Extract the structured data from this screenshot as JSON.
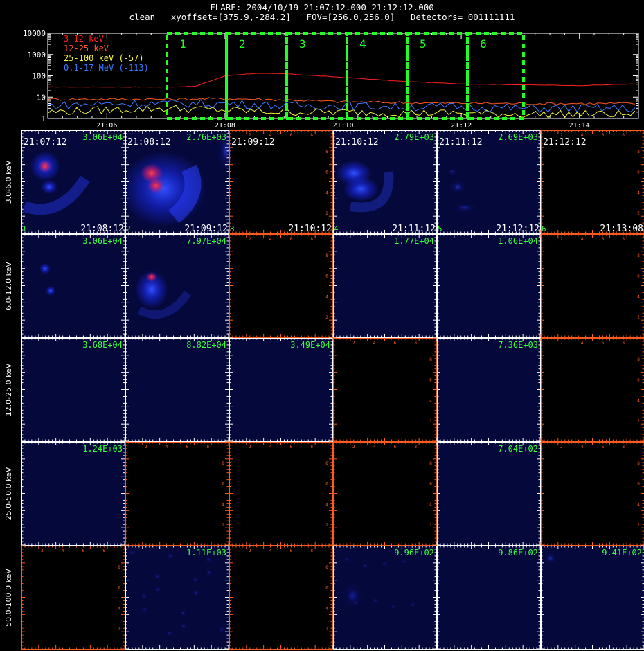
{
  "header": {
    "title_line1": "FLARE: 2004/10/19 21:07:12.000-21:12:12.000",
    "title_line2": "clean   xyoffset=[375.9,-284.2]   FOV=[256.0,256.0]   Detectors= 001111111"
  },
  "colors": {
    "band_3_12": "#ff2020",
    "band_12_25": "#ff5a1e",
    "band_25_100": "#f5f53c",
    "band_0p1_17": "#3c78ff",
    "interval_box": "#22ff22",
    "panel_label": "#3cff3c",
    "axis_orange": "#ff5a1e"
  },
  "chart_data": [
    {
      "type": "line",
      "yscale": "log",
      "ylim": [
        1,
        10000
      ],
      "y_ticks": [
        "1",
        "10",
        "100",
        "1000",
        "10000"
      ],
      "x_tick_labels": [
        "21:06",
        "21:08",
        "21:10",
        "21:12",
        "21:14"
      ],
      "xlim_minutes": [
        "21:05:00",
        "21:15:00"
      ],
      "legend_position": "top-left",
      "series": [
        {
          "name": "3-12 keV",
          "color_key": "band_3_12",
          "x": [
            "21:05",
            "21:06",
            "21:07",
            "21:07:30",
            "21:08",
            "21:08:30",
            "21:09",
            "21:10",
            "21:11",
            "21:12",
            "21:13",
            "21:14",
            "21:15"
          ],
          "y": [
            30,
            30,
            30,
            32,
            100,
            130,
            125,
            85,
            55,
            42,
            38,
            35,
            42
          ]
        },
        {
          "name": "12-25 keV",
          "color_key": "band_12_25",
          "x": [
            "21:05",
            "21:06",
            "21:07",
            "21:08",
            "21:09",
            "21:10",
            "21:11",
            "21:12",
            "21:13",
            "21:14",
            "21:15"
          ],
          "y": [
            8,
            8,
            8,
            8.5,
            7.5,
            6,
            5.5,
            5.2,
            5,
            5,
            5
          ]
        },
        {
          "name": "25-100 keV (-57)",
          "color_key": "band_25_100",
          "x": [
            "21:05",
            "21:06",
            "21:07",
            "21:08",
            "21:09",
            "21:10",
            "21:11",
            "21:12",
            "21:13",
            "21:14",
            "21:15"
          ],
          "y": [
            2,
            2.5,
            3,
            2.5,
            2,
            2,
            1.8,
            1.8,
            1.6,
            1.6,
            1.6
          ]
        },
        {
          "name": "0.1-17 MeV (-113)",
          "color_key": "band_0p1_17",
          "x": [
            "21:05",
            "21:06",
            "21:07",
            "21:08",
            "21:09",
            "21:10",
            "21:11",
            "21:12",
            "21:13",
            "21:14",
            "21:15"
          ],
          "y": [
            4,
            5,
            5,
            5,
            4,
            4,
            3.5,
            3.5,
            3,
            3,
            3
          ]
        }
      ],
      "intervals": [
        "1",
        "2",
        "3",
        "4",
        "5",
        "6"
      ]
    },
    {
      "type": "heatmap",
      "row_labels": [
        "3.0-6.0 keV",
        "6.0-12.0 keV",
        "12.0-25.0 keV",
        "25.0-50.0 keV",
        "50.0-100.0 keV"
      ],
      "tick_labels": [
        "2",
        "4",
        "6",
        "8"
      ],
      "row1_start_times": [
        "21:07:12",
        "21:08:12",
        "21:09:12",
        "21:10:12",
        "21:11:12",
        "21:12:12"
      ],
      "row1_end_times": [
        "21:08:12",
        "21:09:12",
        "21:10:12",
        "21:11:12",
        "21:12:12",
        "21:13:08"
      ],
      "column_numbers": [
        "1",
        "2",
        "3",
        "4",
        "5",
        "6"
      ],
      "max_values": [
        [
          "3.06E+04",
          "2.76E+03",
          "",
          "2.79E+03",
          "2.69E+03",
          ""
        ],
        [
          "3.06E+04",
          "7.97E+04",
          "",
          "1.77E+04",
          "1.06E+04",
          ""
        ],
        [
          "3.68E+04",
          "8.82E+04",
          "3.49E+04",
          "",
          "7.36E+03",
          ""
        ],
        [
          "1.24E+03",
          "",
          "",
          "",
          "7.04E+02",
          ""
        ],
        [
          "",
          "1.11E+03",
          "",
          "9.96E+02",
          "9.86E+02",
          "9.41E+02"
        ]
      ],
      "panel_images": [
        [
          "a",
          "b",
          "n",
          "c",
          "d",
          "n"
        ],
        [
          "e",
          "f",
          "n",
          "g",
          "g",
          "n"
        ],
        [
          "g",
          "g",
          "g",
          "n",
          "g",
          "n"
        ],
        [
          "g",
          "n",
          "n",
          "n",
          "g",
          "n"
        ],
        [
          "n",
          "h",
          "n",
          "i",
          "g",
          "j"
        ]
      ]
    }
  ]
}
